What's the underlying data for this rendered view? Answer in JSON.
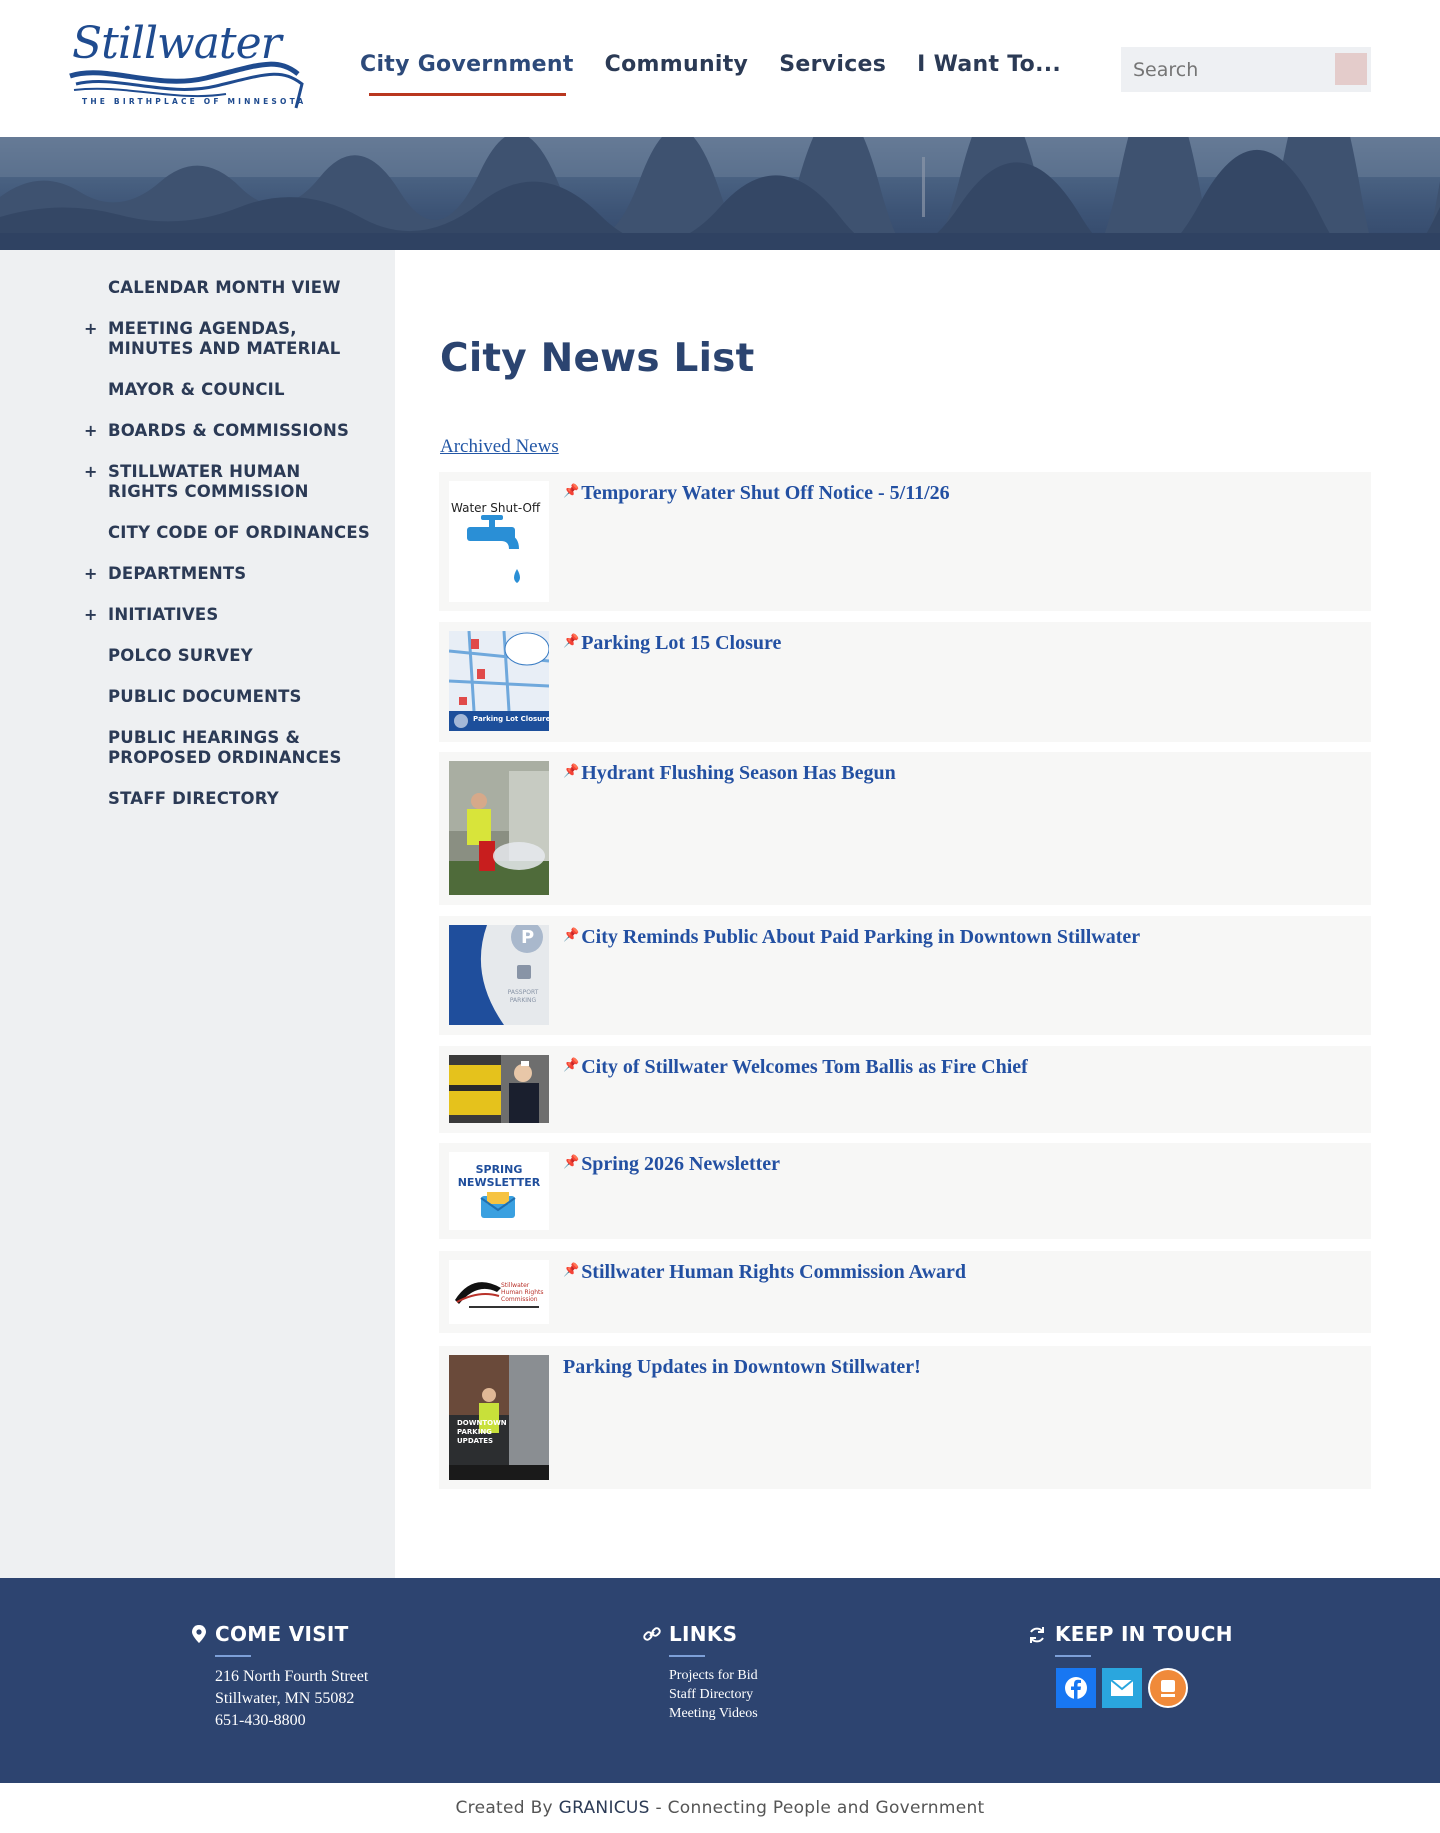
{
  "header": {
    "logo_text": "Stillwater",
    "logo_tagline": "THE BIRTHPLACE OF MINNESOTA",
    "nav": [
      {
        "label": "City Government",
        "active": true
      },
      {
        "label": "Community",
        "active": false
      },
      {
        "label": "Services",
        "active": false
      },
      {
        "label": "I Want To...",
        "active": false
      }
    ],
    "search_placeholder": "Search"
  },
  "sidebar": {
    "items": [
      {
        "label": "CALENDAR MONTH VIEW",
        "expandable": false
      },
      {
        "label": "MEETING AGENDAS, MINUTES AND MATERIAL",
        "expandable": true
      },
      {
        "label": "MAYOR & COUNCIL",
        "expandable": false
      },
      {
        "label": "BOARDS & COMMISSIONS",
        "expandable": true
      },
      {
        "label": "STILLWATER HUMAN RIGHTS COMMISSION",
        "expandable": true
      },
      {
        "label": "CITY CODE OF ORDINANCES",
        "expandable": false
      },
      {
        "label": "DEPARTMENTS",
        "expandable": true
      },
      {
        "label": "INITIATIVES",
        "expandable": true
      },
      {
        "label": "POLCO SURVEY",
        "expandable": false
      },
      {
        "label": "PUBLIC DOCUMENTS",
        "expandable": false
      },
      {
        "label": "PUBLIC HEARINGS & PROPOSED ORDINANCES",
        "expandable": false
      },
      {
        "label": "STAFF DIRECTORY",
        "expandable": false
      }
    ],
    "expand_symbol": "+"
  },
  "main": {
    "title": "City News List",
    "archived_link": "Archived News",
    "pin_symbol": "📌",
    "news": [
      {
        "title": "Temporary Water Shut Off Notice - 5/11/26",
        "pinned": true,
        "thumb_caption": "Water Shut-Off"
      },
      {
        "title": "Parking Lot 15 Closure",
        "pinned": true,
        "thumb_caption": "Parking Lot Closure"
      },
      {
        "title": "Hydrant Flushing Season Has Begun",
        "pinned": true,
        "thumb_caption": ""
      },
      {
        "title": "City Reminds Public About Paid Parking in Downtown Stillwater",
        "pinned": true,
        "thumb_caption": "PASSPORT PARKING"
      },
      {
        "title": "City of Stillwater Welcomes Tom Ballis as Fire Chief",
        "pinned": true,
        "thumb_caption": ""
      },
      {
        "title": "Spring 2026 Newsletter",
        "pinned": true,
        "thumb_caption": "SPRING NEWSLETTER"
      },
      {
        "title": "Stillwater Human Rights Commission Award",
        "pinned": true,
        "thumb_caption": "Stillwater Human Rights Commission"
      },
      {
        "title": "Parking Updates in Downtown Stillwater!",
        "pinned": false,
        "thumb_caption": "DOWNTOWN PARKING UPDATES"
      }
    ]
  },
  "footer": {
    "visit": {
      "heading": "COME VISIT",
      "address1": "216 North Fourth Street",
      "address2": "Stillwater, MN 55082",
      "phone": "651-430-8800"
    },
    "links": {
      "heading": "LINKS",
      "items": [
        "Projects for Bid",
        "Staff Directory",
        "Meeting Videos"
      ]
    },
    "touch": {
      "heading": "KEEP IN TOUCH",
      "icons": [
        "facebook-icon",
        "email-icon",
        "notify-me-icon"
      ],
      "colors": {
        "facebook": "#1877f2",
        "email": "#2aa6de",
        "notify": "#f08a3a"
      }
    },
    "credit_prefix": "Created By ",
    "credit_brand": "GRANICUS",
    "credit_suffix": " - Connecting People and Government"
  },
  "colors": {
    "accent_underline": "#b9371f",
    "footer_bg": "#2d4470",
    "link_blue": "#2350a2",
    "sidebar_bg": "#eef0f2"
  }
}
